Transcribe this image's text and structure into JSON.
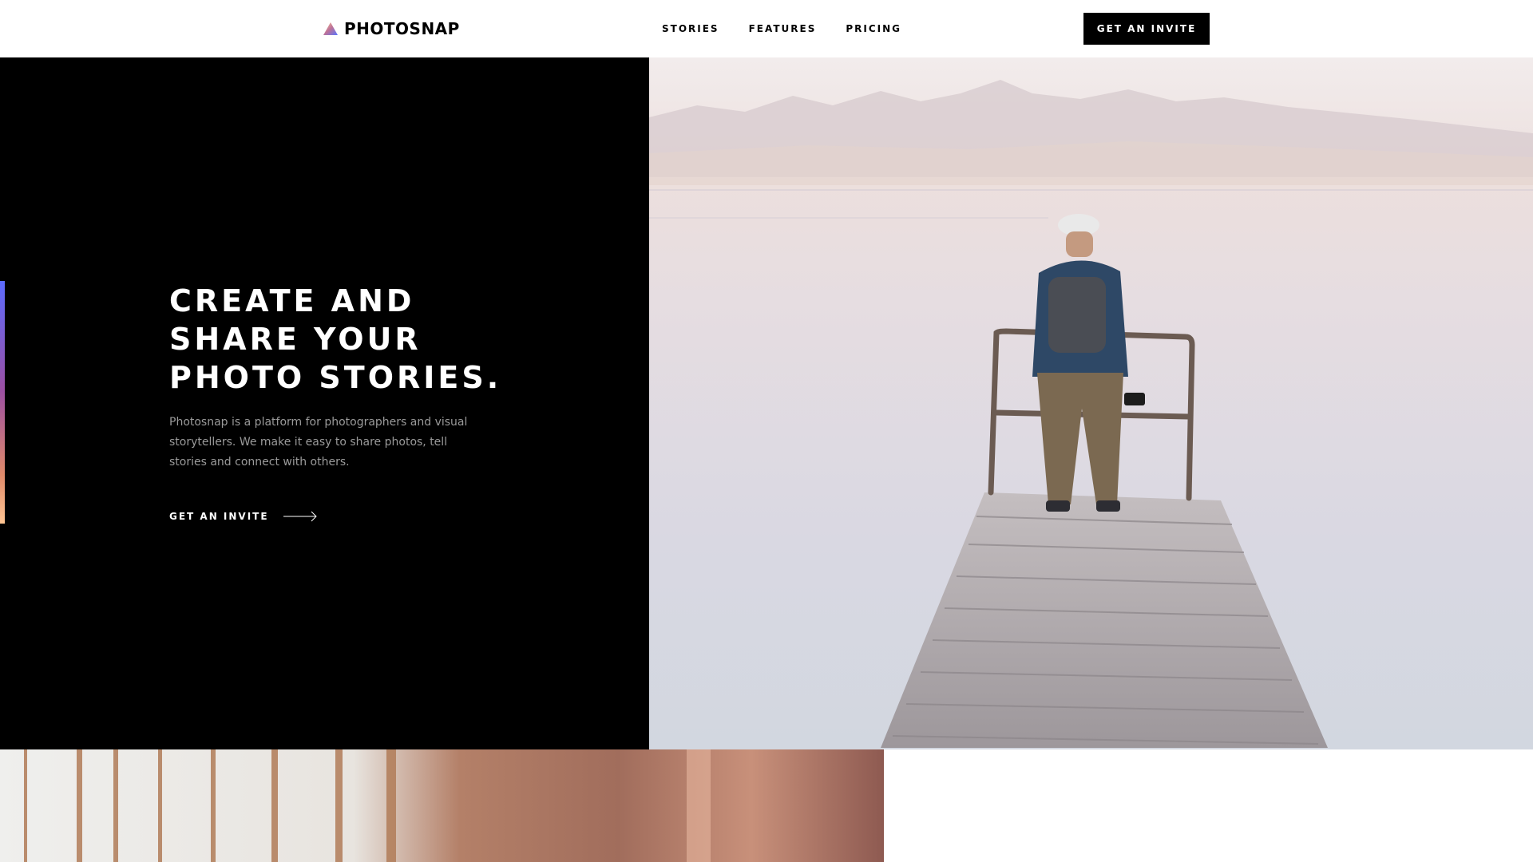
{
  "brand": {
    "name": "PHOTOSNAP",
    "logo_icon": "gradient-triangle-icon"
  },
  "nav": {
    "items": [
      {
        "label": "STORIES"
      },
      {
        "label": "FEATURES"
      },
      {
        "label": "PRICING"
      }
    ],
    "cta_label": "GET AN INVITE"
  },
  "hero": {
    "title_lines": [
      "CREATE AND",
      "SHARE YOUR",
      "PHOTO STORIES."
    ],
    "description": "Photosnap is a platform for photographers and visual storytellers. We make it easy to share photos, tell stories and connect with others.",
    "cta_label": "GET AN INVITE",
    "cta_icon": "arrow-right-icon",
    "photo": "person-on-dock-photo"
  },
  "feature_section": {
    "photo": "window-blinds-photo"
  },
  "colors": {
    "accent_gradient": [
      "#5c6bff",
      "#9b4fa3",
      "#ffc593"
    ],
    "hero_bg": "#000000",
    "text_muted": "#9a9a9a",
    "button_bg": "#000000"
  }
}
